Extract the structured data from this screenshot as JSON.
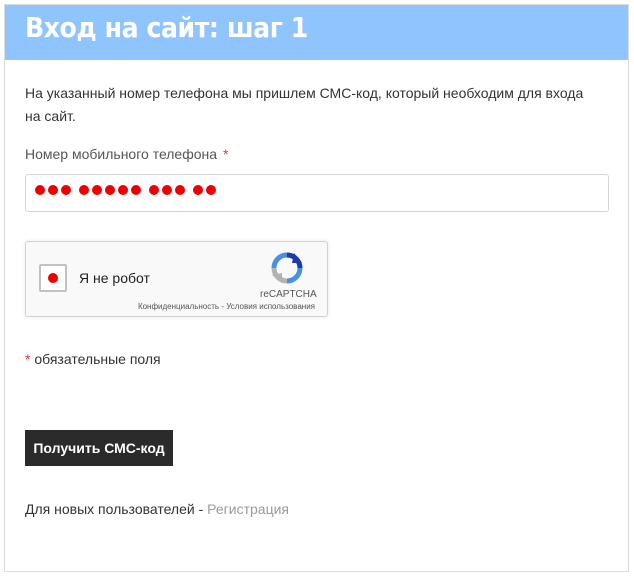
{
  "header": {
    "title": "Вход на сайт: шаг 1"
  },
  "intro": {
    "text": "На указанный номер телефона мы пришлем СМС-код, который необходим для входа на сайт."
  },
  "phone": {
    "label": "Номер мобильного телефона",
    "required_mark": "*"
  },
  "recaptcha": {
    "checkbox_label": "Я не робот",
    "brand": "reCAPTCHA",
    "privacy": "Конфиденциальность",
    "separator": " - ",
    "terms": "Условия использования"
  },
  "required_note": {
    "mark": "*",
    "text": " обязательные поля"
  },
  "submit": {
    "label": "Получить СМС-код"
  },
  "footer": {
    "text": "Для новых пользователей - ",
    "link": "Регистрация"
  },
  "colors": {
    "header_bg": "#8fc4ff",
    "button_bg": "#2b2b2b",
    "required": "#e53935",
    "redaction": "#ee0000"
  }
}
